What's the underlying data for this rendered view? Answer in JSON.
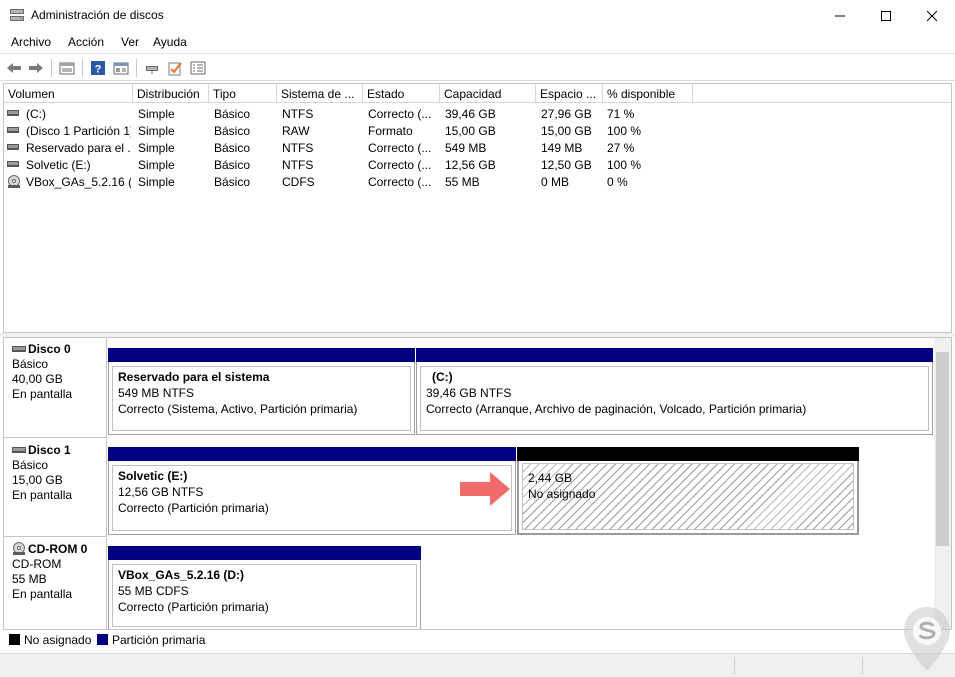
{
  "window": {
    "title": "Administración de discos"
  },
  "menu": [
    "Archivo",
    "Acción",
    "Ver",
    "Ayuda"
  ],
  "toolbar_icons": [
    "back-icon",
    "forward-icon",
    "properties-icon",
    "help-icon",
    "console-icon",
    "connect-icon",
    "check-icon",
    "list-icon"
  ],
  "volume_table": {
    "columns": [
      "Volumen",
      "Distribución",
      "Tipo",
      "Sistema de ...",
      "Estado",
      "Capacidad",
      "Espacio ...",
      "% disponible"
    ],
    "rows": [
      [
        "(C:)",
        "Simple",
        "Básico",
        "NTFS",
        "Correcto (...",
        "39,46 GB",
        "27,96 GB",
        "71 %"
      ],
      [
        "(Disco 1 Partición 1)",
        "Simple",
        "Básico",
        "RAW",
        "Formato",
        "15,00 GB",
        "15,00 GB",
        "100 %"
      ],
      [
        "Reservado para el ...",
        "Simple",
        "Básico",
        "NTFS",
        "Correcto (...",
        "549 MB",
        "149 MB",
        "27 %"
      ],
      [
        "Solvetic (E:)",
        "Simple",
        "Básico",
        "NTFS",
        "Correcto (...",
        "12,56 GB",
        "12,50 GB",
        "100 %"
      ],
      [
        "VBox_GAs_5.2.16 (...",
        "Simple",
        "Básico",
        "CDFS",
        "Correcto (...",
        "55 MB",
        "0 MB",
        "0 %"
      ]
    ]
  },
  "disks": [
    {
      "name": "Disco 0",
      "type": "Básico",
      "size": "40,00 GB",
      "status": "En pantalla",
      "partitions": [
        {
          "name": "Reservado para el sistema",
          "size": "549 MB NTFS",
          "status": "Correcto (Sistema, Activo, Partición primaria)"
        },
        {
          "name": "(C:)",
          "size": "39,46 GB NTFS",
          "status": "Correcto (Arranque, Archivo de paginación, Volcado, Partición primaria)"
        }
      ]
    },
    {
      "name": "Disco 1",
      "type": "Básico",
      "size": "15,00 GB",
      "status": "En pantalla",
      "partitions": [
        {
          "name": "Solvetic  (E:)",
          "size": "12,56 GB NTFS",
          "status": "Correcto (Partición primaria)"
        },
        {
          "name": "",
          "size": "2,44 GB",
          "status": "No asignado"
        }
      ]
    },
    {
      "name": "CD-ROM 0",
      "type": "CD-ROM",
      "size": "55 MB",
      "status": "En pantalla",
      "partitions": [
        {
          "name": "VBox_GAs_5.2.16  (D:)",
          "size": "55 MB CDFS",
          "status": "Correcto (Partición primaria)"
        }
      ]
    }
  ],
  "legend": [
    {
      "label": "No asignado",
      "color": "#000000"
    },
    {
      "label": "Partición primaria",
      "color": "#000080"
    }
  ],
  "colors": {
    "primary_bar": "#000080",
    "unallocated_bar": "#000000",
    "arrow": "#f26b6b"
  }
}
